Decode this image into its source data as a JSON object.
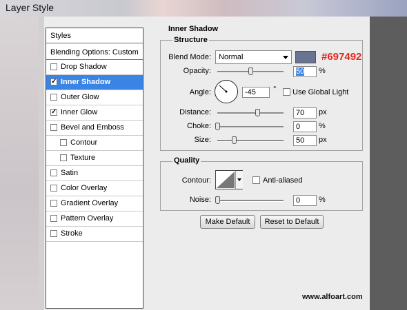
{
  "window": {
    "title": "Layer Style"
  },
  "styles_panel": {
    "header": "Styles",
    "blending_options": "Blending Options: Custom",
    "items": [
      {
        "label": "Drop Shadow",
        "checked": false,
        "selected": false,
        "indent": false
      },
      {
        "label": "Inner Shadow",
        "checked": true,
        "selected": true,
        "indent": false
      },
      {
        "label": "Outer Glow",
        "checked": false,
        "selected": false,
        "indent": false
      },
      {
        "label": "Inner Glow",
        "checked": true,
        "selected": false,
        "indent": false
      },
      {
        "label": "Bevel and Emboss",
        "checked": false,
        "selected": false,
        "indent": false
      },
      {
        "label": "Contour",
        "checked": false,
        "selected": false,
        "indent": true
      },
      {
        "label": "Texture",
        "checked": false,
        "selected": false,
        "indent": true
      },
      {
        "label": "Satin",
        "checked": false,
        "selected": false,
        "indent": false
      },
      {
        "label": "Color Overlay",
        "checked": false,
        "selected": false,
        "indent": false
      },
      {
        "label": "Gradient Overlay",
        "checked": false,
        "selected": false,
        "indent": false
      },
      {
        "label": "Pattern Overlay",
        "checked": false,
        "selected": false,
        "indent": false
      },
      {
        "label": "Stroke",
        "checked": false,
        "selected": false,
        "indent": false
      }
    ]
  },
  "inner_shadow": {
    "title": "Inner Shadow",
    "structure_title": "Structure",
    "blend_mode_label": "Blend Mode:",
    "blend_mode_value": "Normal",
    "swatch_color": "#697492",
    "swatch_annotation": "#697492",
    "opacity_label": "Opacity:",
    "opacity_value": "50",
    "opacity_unit": "%",
    "opacity_slider": 0.5,
    "angle_label": "Angle:",
    "angle_value": "-45",
    "angle_unit": "°",
    "global_light_label": "Use Global Light",
    "distance_label": "Distance:",
    "distance_value": "70",
    "distance_unit": "px",
    "distance_slider": 0.6,
    "choke_label": "Choke:",
    "choke_value": "0",
    "choke_unit": "%",
    "choke_slider": 0,
    "size_label": "Size:",
    "size_value": "50",
    "size_unit": "px",
    "size_slider": 0.25,
    "quality_title": "Quality",
    "contour_label": "Contour:",
    "anti_aliased_label": "Anti-aliased",
    "noise_label": "Noise:",
    "noise_value": "0",
    "noise_unit": "%",
    "noise_slider": 0,
    "make_default": "Make Default",
    "reset_default": "Reset to Default"
  },
  "watermark": "www.alfoart.com",
  "colors": {
    "selection": "#3a84e6",
    "annotation": "#e8261e"
  }
}
